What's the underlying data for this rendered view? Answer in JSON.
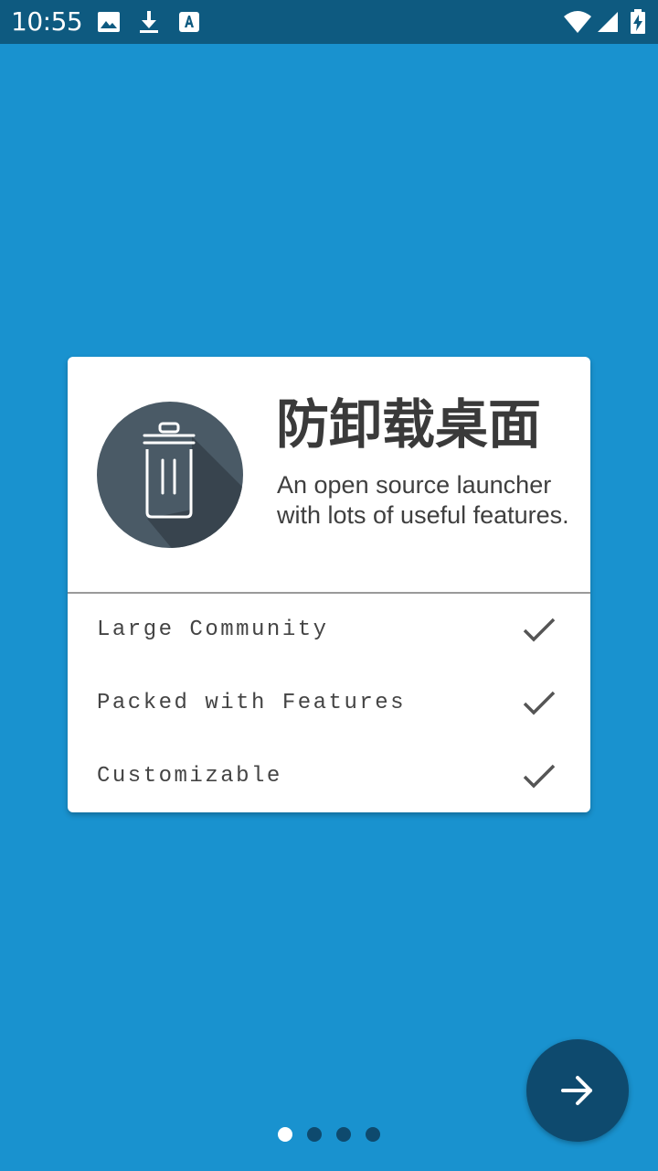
{
  "status_bar": {
    "time": "10:55",
    "left_icons": [
      "image-icon",
      "download-icon",
      "font-icon"
    ],
    "right_icons": [
      "wifi-icon",
      "signal-icon",
      "battery-icon"
    ]
  },
  "intro_card": {
    "app_name": "防卸载桌面",
    "description": "An open source launcher with lots of useful features.",
    "logo_icon": "trash-can-icon",
    "features": [
      {
        "label": "Large Community",
        "icon": "checkmark-icon"
      },
      {
        "label": "Packed with Features",
        "icon": "checkmark-icon"
      },
      {
        "label": "Customizable",
        "icon": "checkmark-icon"
      }
    ]
  },
  "navigation": {
    "next_icon": "arrow-right-icon",
    "page_count": 4,
    "current_page": 1
  },
  "colors": {
    "background": "#1992CF",
    "status_bar": "#0E5A80",
    "accent_dark": "#0E4A6E",
    "card": "#FFFFFF",
    "logo_circle": "#4A5A66"
  }
}
